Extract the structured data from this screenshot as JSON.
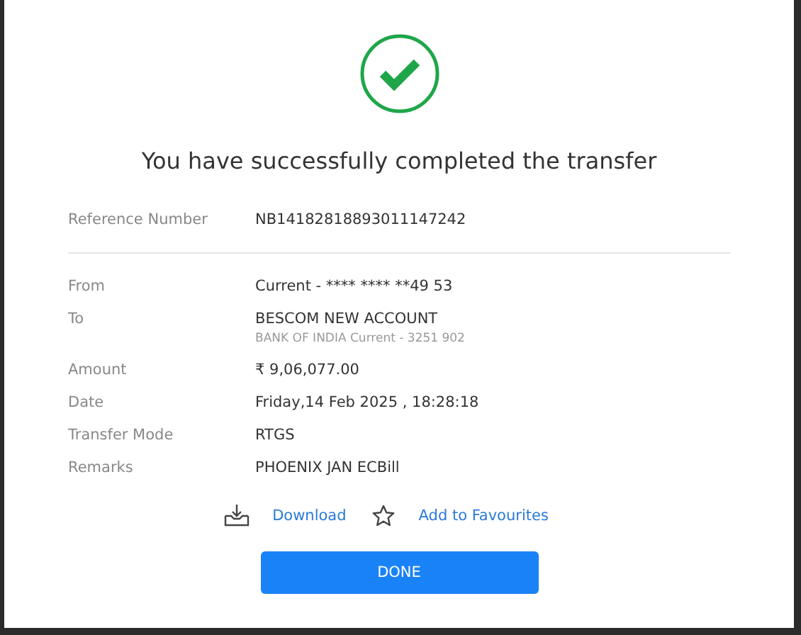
{
  "title": "You have successfully completed the transfer",
  "reference": {
    "label": "Reference Number",
    "value": "NB14182818893011147242"
  },
  "details": [
    {
      "label": "From",
      "value": "Current - **** **** **49 53"
    },
    {
      "label": "To",
      "value": "BESCOM NEW ACCOUNT",
      "sub": "BANK OF INDIA Current - 3251 902"
    },
    {
      "label": "Amount",
      "value": "₹ 9,06,077.00"
    },
    {
      "label": "Date",
      "value": "Friday,14 Feb 2025 , 18:28:18"
    },
    {
      "label": "Transfer Mode",
      "value": "RTGS"
    },
    {
      "label": "Remarks",
      "value": "PHOENIX JAN ECBill"
    }
  ],
  "actions": [
    {
      "kind": "download",
      "label": "Download"
    },
    {
      "kind": "favourite",
      "label": "Add to Favourites"
    }
  ],
  "button": "DONE"
}
